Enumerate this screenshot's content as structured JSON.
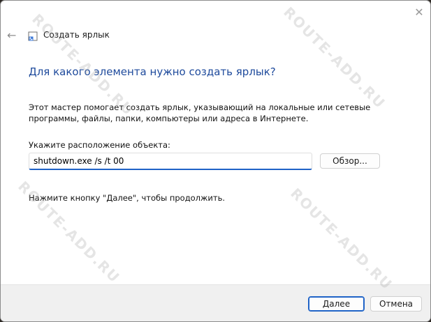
{
  "window": {
    "wizard_title": "Создать ярлык",
    "close_glyph": "✕",
    "back_glyph": "←"
  },
  "content": {
    "question": "Для какого элемента нужно создать ярлык?",
    "description": "Этот мастер помогает создать ярлык, указывающий на локальные или сетевые программы, файлы, папки, компьютеры или адреса в Интернете.",
    "location_label": "Укажите расположение объекта:",
    "location_value": "shutdown.exe /s /t 00",
    "browse_label": "Обзор...",
    "hint": "Нажмите кнопку \"Далее\", чтобы продолжить."
  },
  "footer": {
    "next_label": "Далее",
    "cancel_label": "Отмена"
  },
  "watermark_text": "ROUTE-ADD.RU",
  "colors": {
    "accent": "#1f63c7",
    "question_text": "#1e4a9c"
  },
  "icons": {
    "back": "arrow-left-icon",
    "close": "close-icon",
    "shortcut": "shortcut-icon"
  }
}
